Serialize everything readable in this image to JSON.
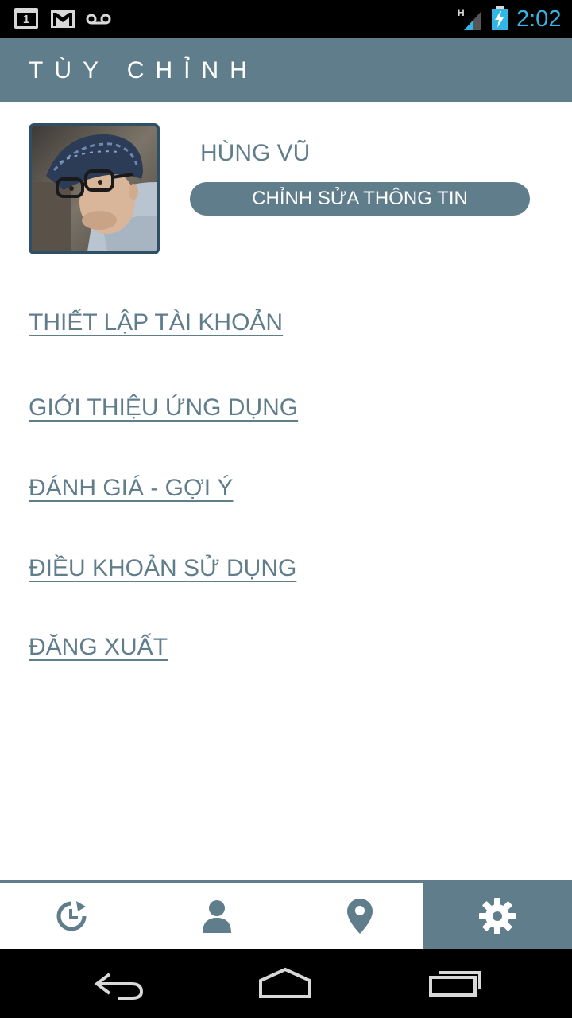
{
  "status_bar": {
    "calendar_day": "1",
    "time": "2:02",
    "network_type": "H",
    "icons": [
      "calendar-icon",
      "gmail-icon",
      "voicemail-icon",
      "signal-icon",
      "battery-charging-icon"
    ]
  },
  "header": {
    "title": "TÙY CHỈNH"
  },
  "profile": {
    "name": "HÙNG VŨ",
    "edit_button": "CHỈNH SỬA THÔNG TIN"
  },
  "menu": {
    "items": [
      {
        "label": "THIẾT LẬP TÀI KHOẢN"
      },
      {
        "label": "GIỚI THIỆU ỨNG DỤNG"
      },
      {
        "label": "ĐÁNH GIÁ - GỢI Ý"
      },
      {
        "label": "ĐIỀU KHOẢN SỬ DỤNG"
      },
      {
        "label": "ĐĂNG XUẤT"
      }
    ]
  },
  "tab_bar": {
    "tabs": [
      {
        "icon": "history-icon",
        "active": false
      },
      {
        "icon": "person-icon",
        "active": false
      },
      {
        "icon": "location-pin-icon",
        "active": false
      },
      {
        "icon": "gear-icon",
        "active": true
      }
    ]
  },
  "nav_bar": {
    "icons": [
      "back-icon",
      "home-icon",
      "recent-apps-icon"
    ]
  },
  "colors": {
    "primary": "#607d8b",
    "status_time": "#33b5e5",
    "avatar_border": "#2e4f66"
  }
}
